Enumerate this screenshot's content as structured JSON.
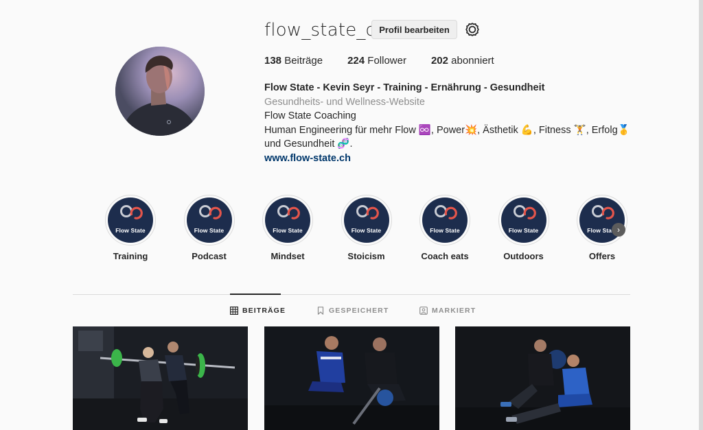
{
  "profile": {
    "username": "flow_state_ch",
    "edit_button_label": "Profil bearbeiten",
    "stats": {
      "posts_count": "138",
      "posts_label": "Beiträge",
      "followers_count": "224",
      "followers_label": "Follower",
      "following_count": "202",
      "following_label": "abonniert"
    },
    "bio": {
      "full_name": "Flow State - Kevin Seyr - Training - Ernährung - Gesundheit",
      "category": "Gesundheits- und Wellness-Website",
      "line1": "Flow State Coaching",
      "line2": "Human Engineering für mehr Flow ♾️, Power💥, Ästhetik 💪, Fitness 🏋️, Erfolg🥇und Gesundheit 🧬.",
      "website": "www.flow-state.ch"
    }
  },
  "highlights": {
    "brand_text": "Flow State",
    "items": [
      {
        "label": "Training"
      },
      {
        "label": "Podcast"
      },
      {
        "label": "Mindset"
      },
      {
        "label": "Stoicism"
      },
      {
        "label": "Coach eats"
      },
      {
        "label": "Outdoors"
      },
      {
        "label": "Offers"
      }
    ],
    "next_arrow_icon": "chevron-right-icon"
  },
  "tabs": [
    {
      "label": "BEITRÄGE",
      "icon": "grid-icon",
      "active": true
    },
    {
      "label": "GESPEICHERT",
      "icon": "bookmark-icon",
      "active": false
    },
    {
      "label": "MARKIERT",
      "icon": "tagged-icon",
      "active": false
    }
  ],
  "colors": {
    "background": "#fafafa",
    "text": "#262626",
    "secondary_text": "#8e8e8e",
    "link": "#00376b",
    "highlight_bg": "#1d2d4d",
    "logo_accent": "#e4554b"
  }
}
